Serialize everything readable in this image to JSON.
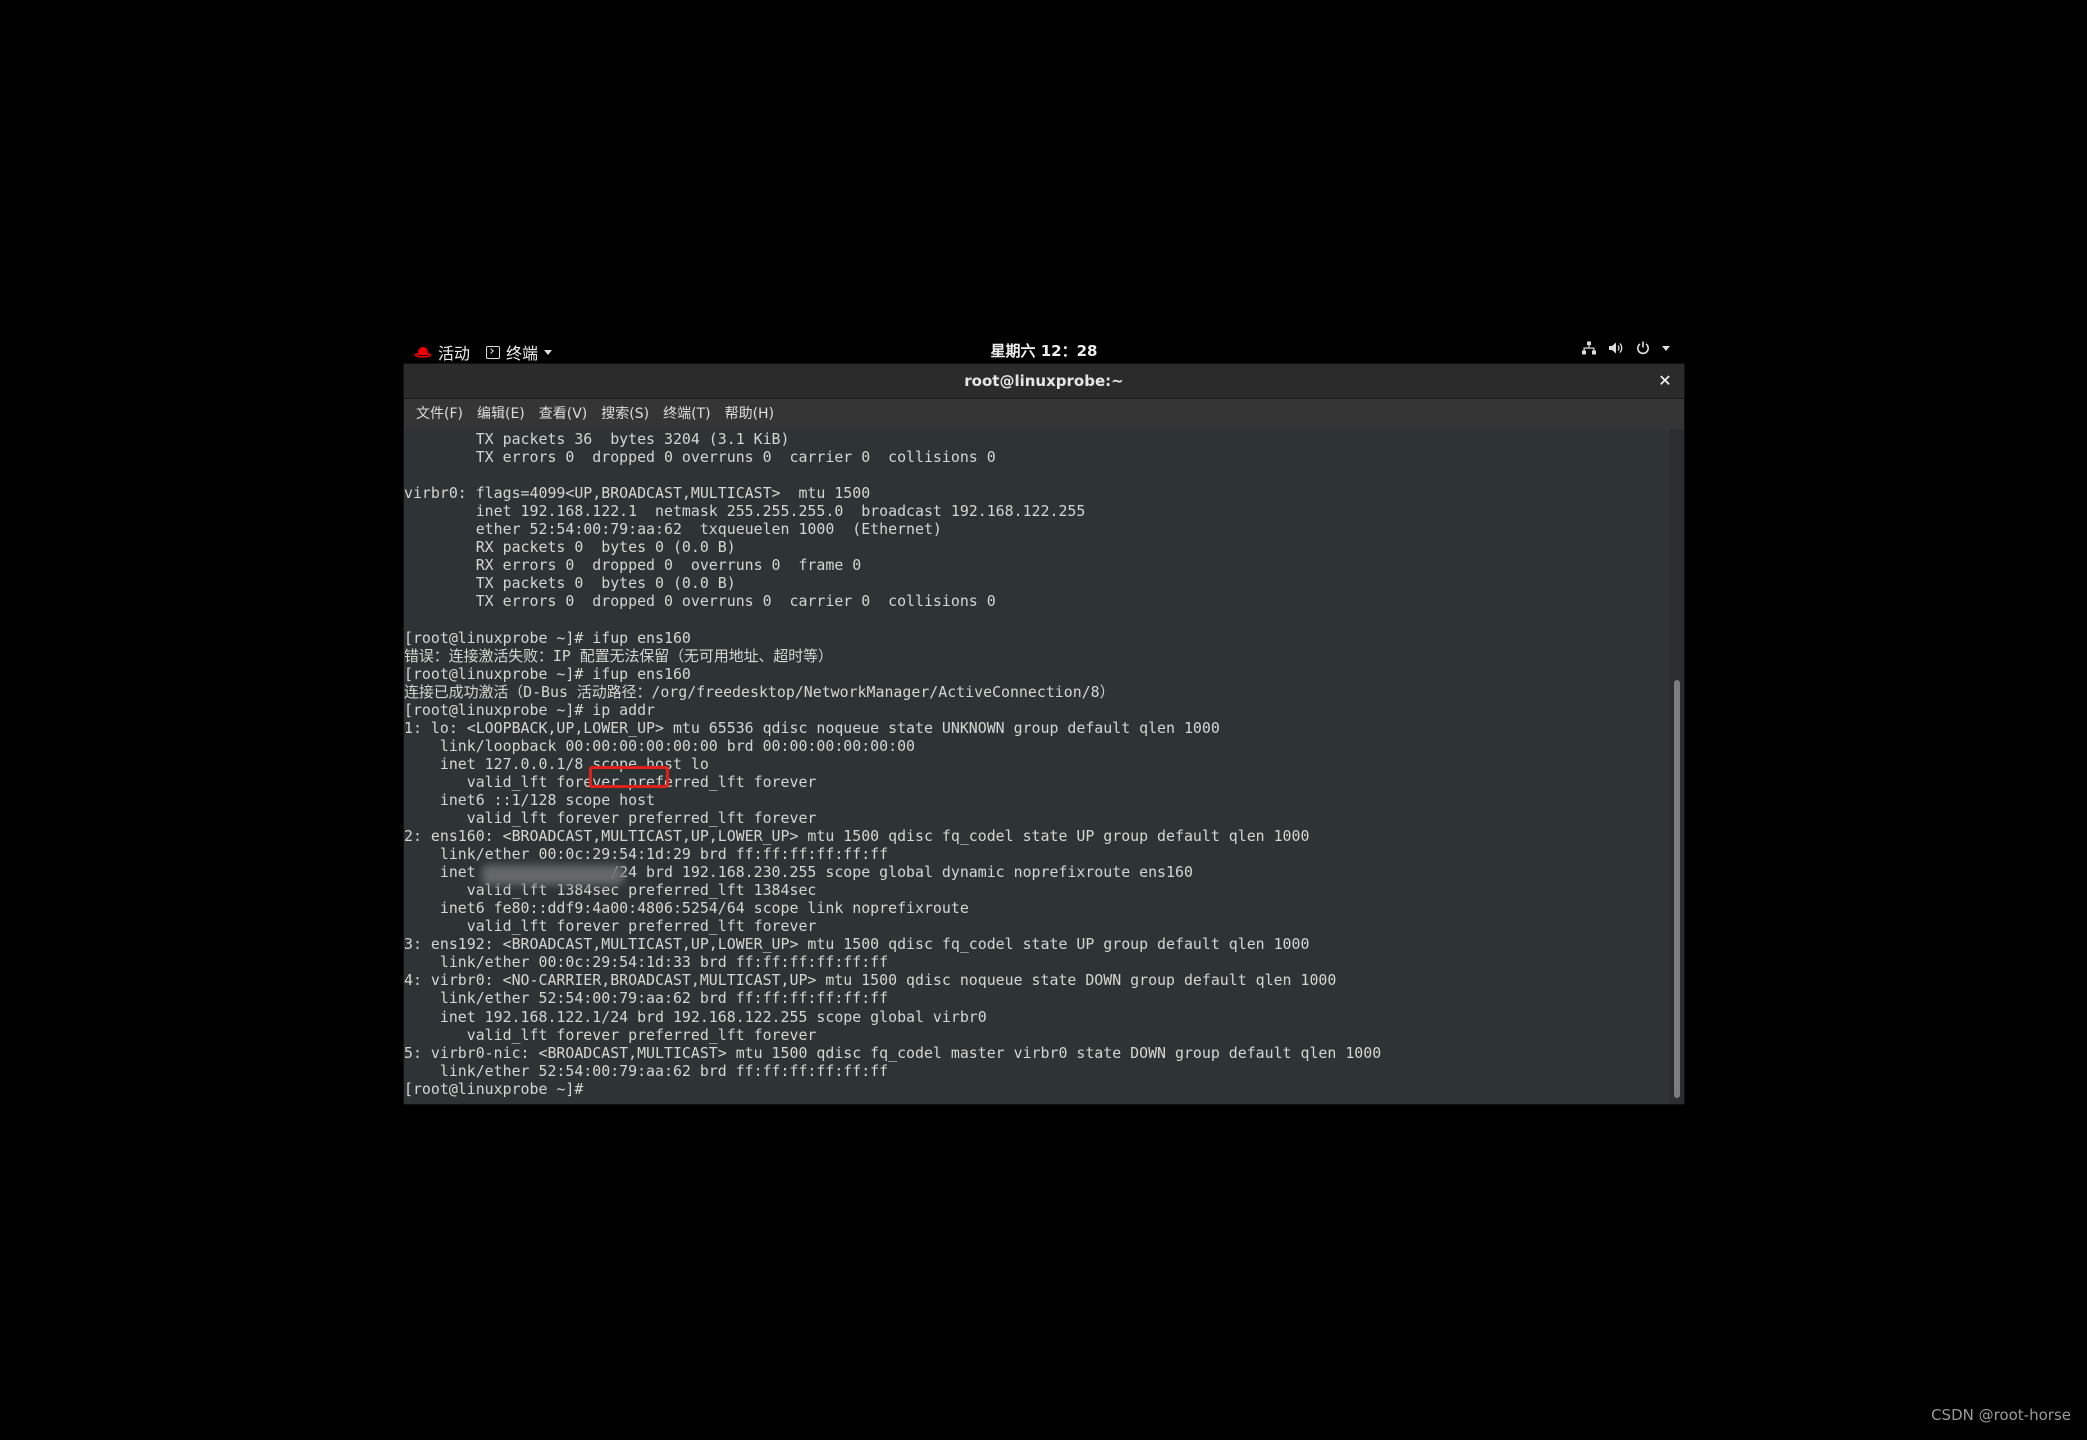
{
  "topbar": {
    "activities_label": "活动",
    "app_menu_label": "终端",
    "clock": "星期六 12：28",
    "icons": [
      "network-icon",
      "volume-icon",
      "power-icon",
      "chevron-down-icon"
    ]
  },
  "window": {
    "title": "root@linuxprobe:~",
    "close_glyph": "✕"
  },
  "menubar": {
    "items": [
      "文件(F)",
      "编辑(E)",
      "查看(V)",
      "搜索(S)",
      "终端(T)",
      "帮助(H)"
    ]
  },
  "terminal": {
    "lines": [
      "        TX packets 36  bytes 3204 (3.1 KiB)",
      "        TX errors 0  dropped 0 overruns 0  carrier 0  collisions 0",
      "",
      "virbr0: flags=4099<UP,BROADCAST,MULTICAST>  mtu 1500",
      "        inet 192.168.122.1  netmask 255.255.255.0  broadcast 192.168.122.255",
      "        ether 52:54:00:79:aa:62  txqueuelen 1000  (Ethernet)",
      "        RX packets 0  bytes 0 (0.0 B)",
      "        RX errors 0  dropped 0  overruns 0  frame 0",
      "        TX packets 0  bytes 0 (0.0 B)",
      "        TX errors 0  dropped 0 overruns 0  carrier 0  collisions 0",
      "",
      "[root@linuxprobe ~]# ifup ens160",
      "错误：连接激活失败：IP 配置无法保留（无可用地址、超时等）",
      "[root@linuxprobe ~]# ifup ens160",
      "连接已成功激活（D-Bus 活动路径：/org/freedesktop/NetworkManager/ActiveConnection/8）",
      "[root@linuxprobe ~]# ip addr",
      "1: lo: <LOOPBACK,UP,LOWER_UP> mtu 65536 qdisc noqueue state UNKNOWN group default qlen 1000",
      "    link/loopback 00:00:00:00:00:00 brd 00:00:00:00:00:00",
      "    inet 127.0.0.1/8 scope host lo",
      "       valid_lft forever preferred_lft forever",
      "    inet6 ::1/128 scope host",
      "       valid_lft forever preferred_lft forever",
      "2: ens160: <BROADCAST,MULTICAST,UP,LOWER_UP> mtu 1500 qdisc fq_codel state UP group default qlen 1000",
      "    link/ether 00:0c:29:54:1d:29 brd ff:ff:ff:ff:ff:ff",
      "    inet               /24 brd 192.168.230.255 scope global dynamic noprefixroute ens160",
      "       valid_lft 1384sec preferred_lft 1384sec",
      "    inet6 fe80::ddf9:4a00:4806:5254/64 scope link noprefixroute",
      "       valid_lft forever preferred_lft forever",
      "3: ens192: <BROADCAST,MULTICAST,UP,LOWER_UP> mtu 1500 qdisc fq_codel state UP group default qlen 1000",
      "    link/ether 00:0c:29:54:1d:33 brd ff:ff:ff:ff:ff:ff",
      "4: virbr0: <NO-CARRIER,BROADCAST,MULTICAST,UP> mtu 1500 qdisc noqueue state DOWN group default qlen 1000",
      "    link/ether 52:54:00:79:aa:62 brd ff:ff:ff:ff:ff:ff",
      "    inet 192.168.122.1/24 brd 192.168.122.255 scope global virbr0",
      "       valid_lft forever preferred_lft forever",
      "5: virbr0-nic: <BROADCAST,MULTICAST> mtu 1500 qdisc fq_codel master virbr0 state DOWN group default qlen 1000",
      "    link/ether 52:54:00:79:aa:62 brd ff:ff:ff:ff:ff:ff",
      "[root@linuxprobe ~]# "
    ]
  },
  "watermark": "CSDN @root-horse",
  "colors": {
    "terminal_bg": "#2e3436",
    "terminal_fg": "#d3d7cf",
    "highlight": "#e0201b",
    "redhat": "#ee0000"
  }
}
